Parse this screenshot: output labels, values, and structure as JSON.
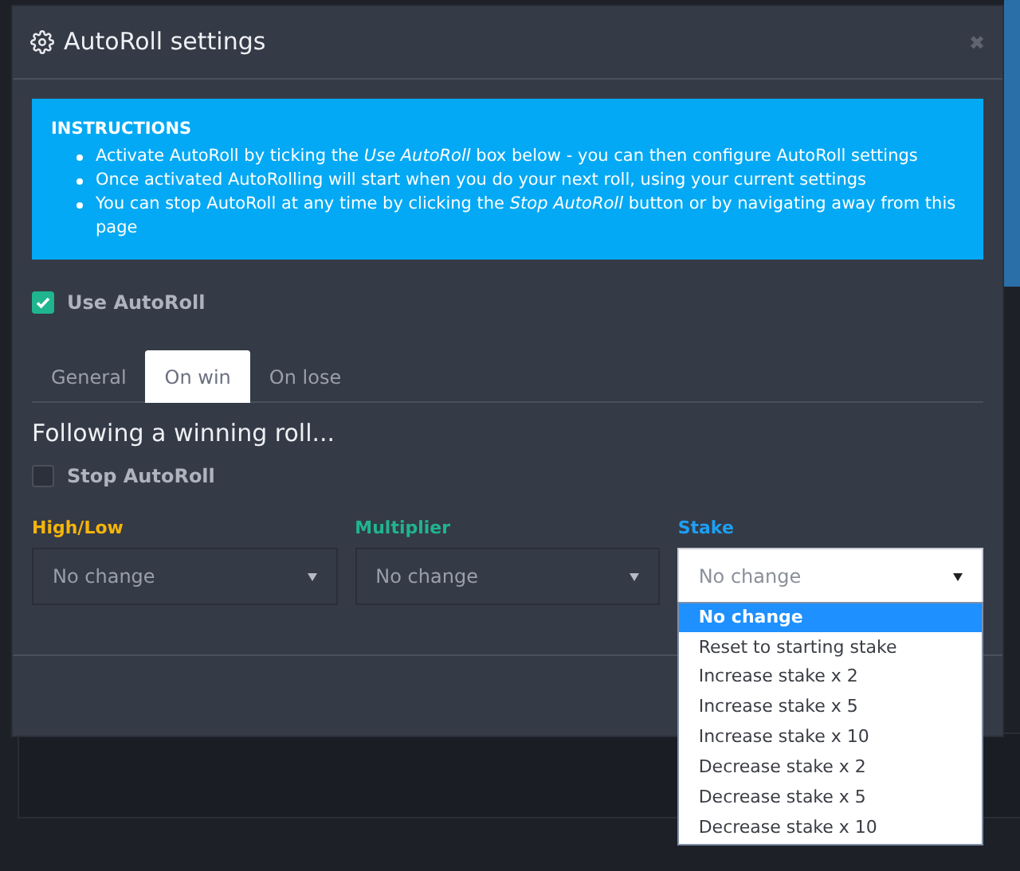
{
  "modal": {
    "title": "AutoRoll settings",
    "close": "✖"
  },
  "instructions": {
    "heading": "INSTRUCTIONS",
    "items": [
      "Activate AutoRoll by ticking the *Use AutoRoll* box below - you can then configure AutoRoll settings",
      "Once activated AutoRolling will start when you do your next roll, using your current settings",
      "You can stop AutoRoll at any time by clicking the *Stop AutoRoll* button or by navigating away from this page"
    ]
  },
  "use_autoroll": {
    "label": "Use AutoRoll",
    "checked": true
  },
  "tabs": [
    {
      "label": "General",
      "selected": false
    },
    {
      "label": "On win",
      "selected": true
    },
    {
      "label": "On lose",
      "selected": false
    }
  ],
  "section_heading": "Following a winning roll...",
  "stop_autoroll": {
    "label": "Stop AutoRoll",
    "checked": false
  },
  "selects": [
    {
      "label": "High/Low",
      "color": "#f5b50a",
      "value": "No change",
      "open": false
    },
    {
      "label": "Multiplier",
      "color": "#1fb58f",
      "value": "No change",
      "open": false
    },
    {
      "label": "Stake",
      "color": "#1e9ff2",
      "value": "No change",
      "open": true
    }
  ],
  "stake_options": [
    {
      "label": "No change",
      "selected": true
    },
    {
      "label": "Reset to starting stake",
      "selected": false
    },
    {
      "label": "Increase stake x 2",
      "selected": false
    },
    {
      "label": "Increase stake x 5",
      "selected": false
    },
    {
      "label": "Increase stake x 10",
      "selected": false
    },
    {
      "label": "Decrease stake x 2",
      "selected": false
    },
    {
      "label": "Decrease stake x 5",
      "selected": false
    },
    {
      "label": "Decrease stake x 10",
      "selected": false
    }
  ]
}
